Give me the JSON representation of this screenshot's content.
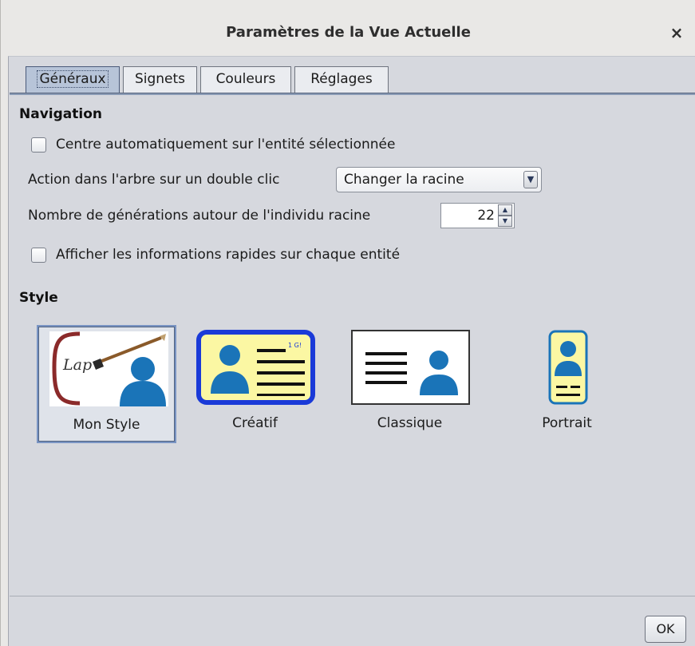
{
  "window": {
    "title": "Paramètres de la Vue Actuelle",
    "close_symbol": "×"
  },
  "tabs": [
    {
      "label": "Généraux",
      "active": true
    },
    {
      "label": "Signets",
      "active": false
    },
    {
      "label": "Couleurs",
      "active": false
    },
    {
      "label": "Réglages",
      "active": false
    }
  ],
  "navigation": {
    "heading": "Navigation",
    "auto_center": {
      "label": "Centre automatiquement sur l'entité sélectionnée",
      "checked": false
    },
    "double_click": {
      "label": "Action dans l'arbre sur un double clic",
      "selected": "Changer la racine"
    },
    "generations": {
      "label": "Nombre de générations autour de l'individu racine",
      "value": "22"
    },
    "quick_info": {
      "label": "Afficher les informations rapides sur chaque entité",
      "checked": false
    }
  },
  "style": {
    "heading": "Style",
    "options": [
      {
        "label": "Mon Style",
        "selected": true,
        "icon": "brush-person-icon",
        "icon_text": "Lap"
      },
      {
        "label": "Créatif",
        "selected": false,
        "icon": "id-card-icon",
        "icon_text": "1 G!"
      },
      {
        "label": "Classique",
        "selected": false,
        "icon": "classic-card-icon"
      },
      {
        "label": "Portrait",
        "selected": false,
        "icon": "portrait-card-icon"
      }
    ]
  },
  "footer": {
    "ok_label": "OK"
  },
  "colors": {
    "accent_blue": "#1a74b8",
    "creative_border": "#1a3ad8",
    "card_yellow": "#fbf7a3",
    "brush_red": "#8b2a2a"
  }
}
